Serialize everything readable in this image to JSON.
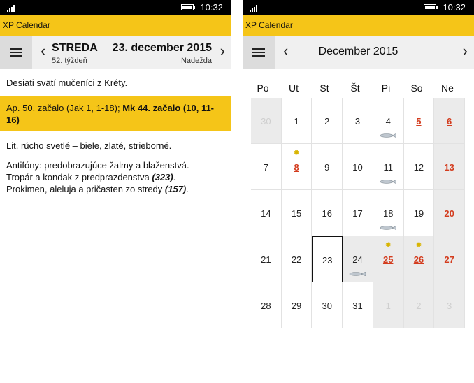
{
  "status": {
    "time": "10:32"
  },
  "left": {
    "app_title": "XP Calendar",
    "toolbar": {
      "day_name": "STREDA",
      "week": "52. týždeň",
      "date": "23. december 2015",
      "name_day": "Nadežda"
    },
    "content": {
      "feast": "Desiati svätí mučeníci z Kréty.",
      "readings_plain": "Ap. 50. začalo (Jak 1, 1-18);",
      "readings_bold": "Mk 44. začalo (10, 11-16)",
      "vestments": "Lit. rúcho svetlé – biele, zlaté, strieborné.",
      "antiphons": "Antifóny: predobrazujúce žalmy a blaženstvá.",
      "troparion_prefix": "Tropár a kondak z predprazdenstva",
      "troparion_ref": "(323)",
      "troparion_suffix": ".",
      "prokimen_prefix": "Prokimen, aleluja a pričasten zo stredy",
      "prokimen_ref": "(157)",
      "prokimen_suffix": "."
    }
  },
  "right": {
    "app_title": "XP Calendar",
    "month_title": "December 2015",
    "weekdays": [
      "Po",
      "Ut",
      "St",
      "Št",
      "Pi",
      "So",
      "Ne"
    ],
    "days": [
      {
        "n": "30",
        "other": true
      },
      {
        "n": "1"
      },
      {
        "n": "2"
      },
      {
        "n": "3"
      },
      {
        "n": "4",
        "fish": true
      },
      {
        "n": "5",
        "red": true,
        "underline": true
      },
      {
        "n": "6",
        "red": true,
        "underline": true,
        "sunday": true
      },
      {
        "n": "7"
      },
      {
        "n": "8",
        "red": true,
        "underline": true,
        "sun": true
      },
      {
        "n": "9"
      },
      {
        "n": "10"
      },
      {
        "n": "11",
        "fish": true
      },
      {
        "n": "12"
      },
      {
        "n": "13",
        "red": true,
        "sunday": true
      },
      {
        "n": "14"
      },
      {
        "n": "15"
      },
      {
        "n": "16"
      },
      {
        "n": "17"
      },
      {
        "n": "18",
        "fish": true
      },
      {
        "n": "19"
      },
      {
        "n": "20",
        "red": true,
        "sunday": true
      },
      {
        "n": "21"
      },
      {
        "n": "22"
      },
      {
        "n": "23",
        "today": true
      },
      {
        "n": "24",
        "fish": true,
        "grey": true
      },
      {
        "n": "25",
        "red": true,
        "underline": true,
        "sun": true,
        "grey": true
      },
      {
        "n": "26",
        "red": true,
        "underline": true,
        "sun": true,
        "grey": true
      },
      {
        "n": "27",
        "red": true,
        "sunday": true
      },
      {
        "n": "28"
      },
      {
        "n": "29"
      },
      {
        "n": "30"
      },
      {
        "n": "31"
      },
      {
        "n": "1",
        "other": true
      },
      {
        "n": "2",
        "other": true
      },
      {
        "n": "3",
        "other": true
      }
    ]
  },
  "icons": {
    "menu": "hamburger-menu-icon",
    "prev": "chevron-left-icon",
    "next": "chevron-right-icon",
    "feast_sun": "sun-icon",
    "fasting": "fish-icon"
  },
  "colors": {
    "accent": "#f5c518",
    "feast_red": "#d33c1e",
    "grey_cell": "#ebebeb",
    "toolbar_bg": "#f0f0f0"
  }
}
